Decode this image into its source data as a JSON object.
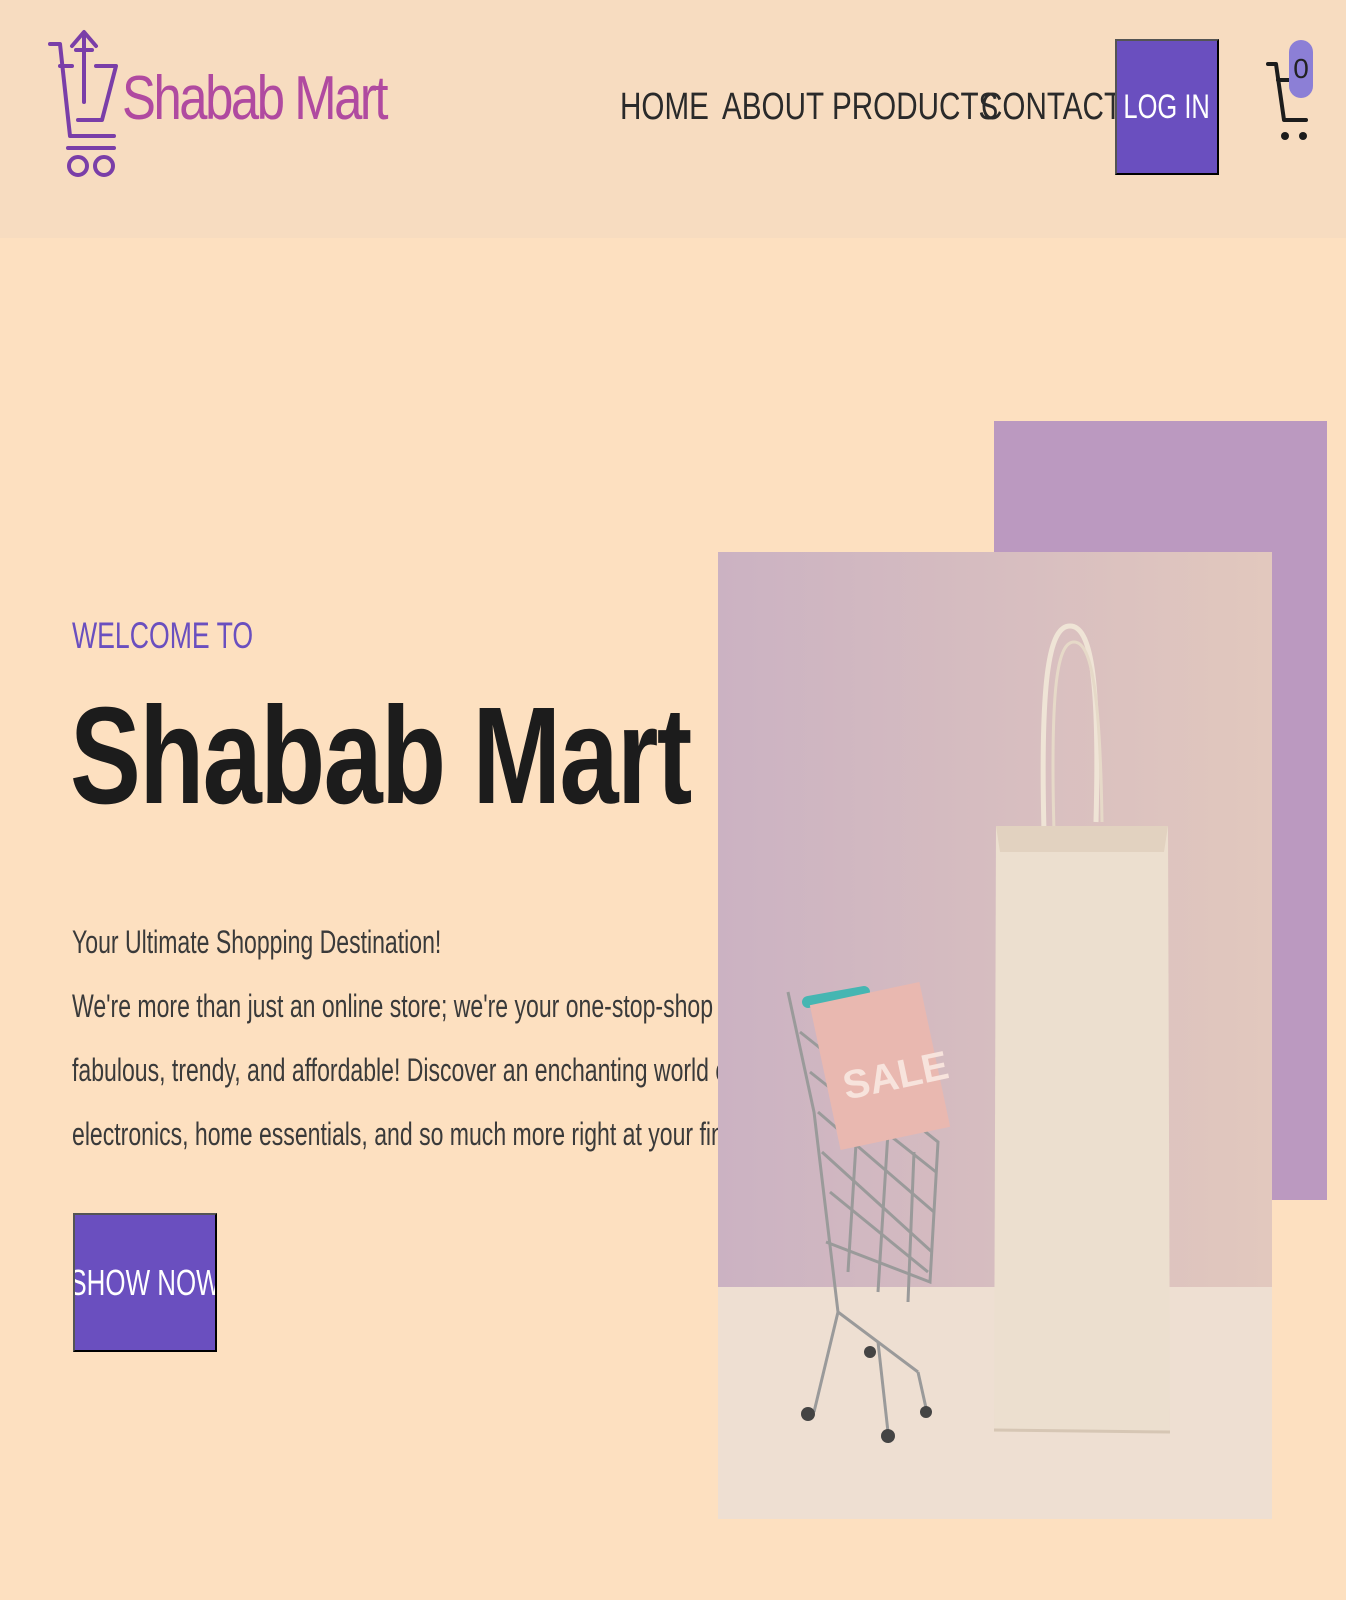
{
  "brand": {
    "name": "Shabab Mart"
  },
  "nav": {
    "items": [
      {
        "label": "HOME"
      },
      {
        "label": "ABOUT"
      },
      {
        "label": "PRODUCTS"
      },
      {
        "label": "CONTACT"
      }
    ],
    "login_label": "LOG IN",
    "cart_count": "0"
  },
  "hero": {
    "eyebrow": "WELCOME TO",
    "title": "Shabab Mart",
    "tagline": "Your Ultimate Shopping Destination!",
    "lines": [
      "We're more than just an online store; we're your one-stop-shop for all things",
      "fabulous, trendy, and affordable! Discover an enchanting world of fashion,",
      "electronics, home essentials, and so much more right at your fingertips."
    ],
    "cta_label": "SHOW NOW",
    "image_sign_text": "SALE"
  },
  "colors": {
    "page_bg": "#fde0c0",
    "header_bg": "#f7dcc0",
    "accent": "#6a4fbf",
    "brand_pink": "#b04aa0",
    "purple_block": "#bb99c0"
  },
  "icons": {
    "logo": "shopping-cart-upload-icon",
    "cart": "cart-icon"
  }
}
